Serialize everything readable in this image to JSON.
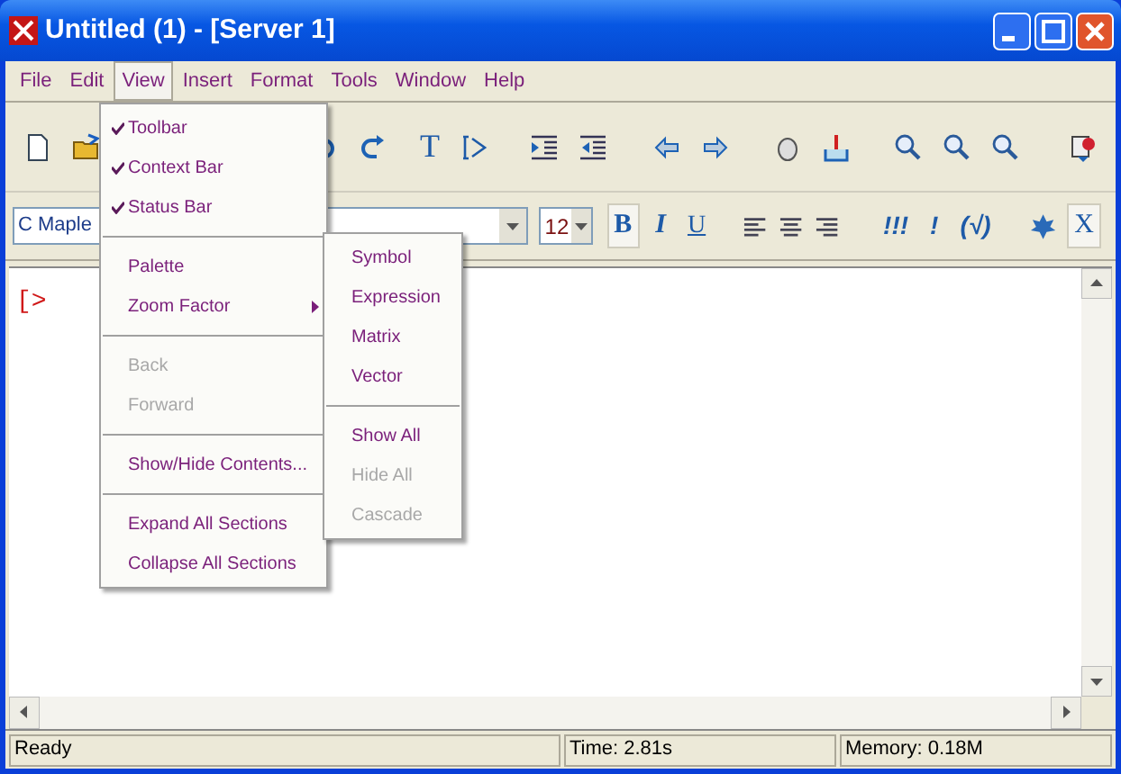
{
  "window": {
    "title": "Untitled (1) - [Server 1]"
  },
  "menubar": [
    {
      "label": "File",
      "selected": false
    },
    {
      "label": "Edit",
      "selected": false
    },
    {
      "label": "View",
      "selected": true
    },
    {
      "label": "Insert",
      "selected": false
    },
    {
      "label": "Format",
      "selected": false
    },
    {
      "label": "Tools",
      "selected": false
    },
    {
      "label": "Window",
      "selected": false
    },
    {
      "label": "Help",
      "selected": false
    }
  ],
  "context_bar": {
    "style_field": "C Maple",
    "font_size": "12",
    "bold": "B",
    "italic": "I",
    "underline": "U",
    "buttons": [
      "!!!",
      "!",
      "(√)"
    ],
    "x_button": "X"
  },
  "toolbar": {
    "t_button": "T"
  },
  "document": {
    "prompt": "[>"
  },
  "view_menu": [
    {
      "kind": "check",
      "label": "Toolbar",
      "checked": true,
      "disabled": false
    },
    {
      "kind": "check",
      "label": "Context Bar",
      "checked": true,
      "disabled": false
    },
    {
      "kind": "check",
      "label": "Status Bar",
      "checked": true,
      "disabled": false
    },
    {
      "kind": "separator"
    },
    {
      "kind": "item",
      "label": "Palette",
      "disabled": false
    },
    {
      "kind": "submenu",
      "label": "Zoom Factor",
      "disabled": false,
      "expanded": true
    },
    {
      "kind": "separator"
    },
    {
      "kind": "item",
      "label": "Back",
      "disabled": true
    },
    {
      "kind": "item",
      "label": "Forward",
      "disabled": true
    },
    {
      "kind": "separator"
    },
    {
      "kind": "item",
      "label": "Show/Hide Contents...",
      "disabled": false
    },
    {
      "kind": "separator"
    },
    {
      "kind": "item",
      "label": "Expand All Sections",
      "disabled": false
    },
    {
      "kind": "item",
      "label": "Collapse All Sections",
      "disabled": false
    }
  ],
  "submenu": [
    {
      "kind": "item",
      "label": "Symbol",
      "disabled": false
    },
    {
      "kind": "item",
      "label": "Expression",
      "disabled": false
    },
    {
      "kind": "item",
      "label": "Matrix",
      "disabled": false
    },
    {
      "kind": "item",
      "label": "Vector",
      "disabled": false
    },
    {
      "kind": "separator"
    },
    {
      "kind": "item",
      "label": "Show All",
      "disabled": false
    },
    {
      "kind": "item",
      "label": "Hide All",
      "disabled": true
    },
    {
      "kind": "item",
      "label": "Cascade",
      "disabled": true
    }
  ],
  "status_bar": [
    "Ready",
    "Time: 2.81s",
    "Memory: 0.18M"
  ]
}
